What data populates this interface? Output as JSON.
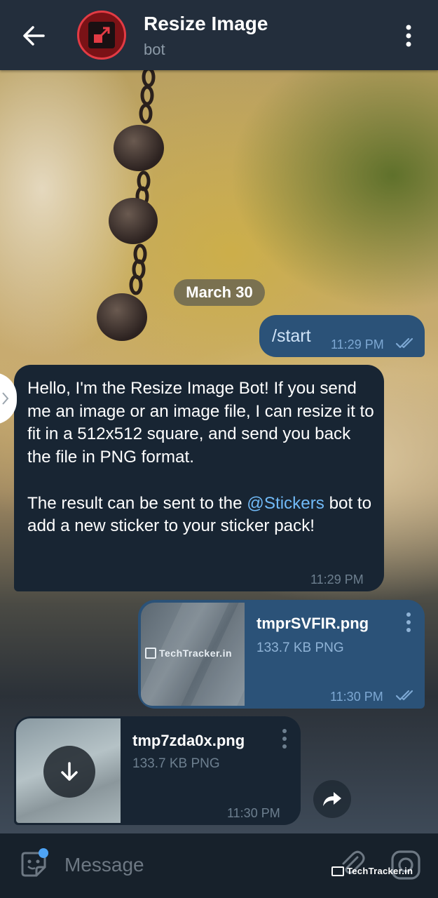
{
  "header": {
    "title": "Resize Image",
    "subtitle": "bot"
  },
  "chat": {
    "date_chip": "March 30",
    "messages": [
      {
        "direction": "out",
        "text": "/start",
        "time": "11:29 PM",
        "status": "read"
      },
      {
        "direction": "in",
        "text_part1": "Hello, I'm the Resize Image Bot! If you send me an image or an image file, I can resize it to fit in a 512x512 square, and send you back the file in PNG format.\n\nThe result can be sent to the ",
        "link": "@Stickers",
        "text_part2": " bot to add a new sticker to your sticker pack!",
        "time": "11:29 PM"
      },
      {
        "direction": "out",
        "type": "file",
        "file_name": "tmprSVFIR.png",
        "file_info": "133.7 KB PNG",
        "thumb_watermark": "TechTracker.in",
        "time": "11:30 PM",
        "status": "read"
      },
      {
        "direction": "in",
        "type": "file",
        "file_name": "tmp7zda0x.png",
        "file_info": "133.7 KB PNG",
        "time": "11:30 PM"
      }
    ]
  },
  "input": {
    "placeholder": "Message"
  },
  "watermark": "TechTracker.in",
  "colors": {
    "header_bg": "#232e3c",
    "outgoing_bubble": "#2b5278",
    "incoming_bubble": "#182533",
    "link": "#71baf7",
    "accent": "#4ea4f6"
  },
  "icons": {
    "back": "arrow-left-icon",
    "menu": "vertical-dots-icon",
    "download": "arrow-down-icon",
    "share": "share-arrow-icon",
    "emoji": "sticker-emoji-icon",
    "attach": "paperclip-icon",
    "camera": "instagram-camera-icon"
  }
}
